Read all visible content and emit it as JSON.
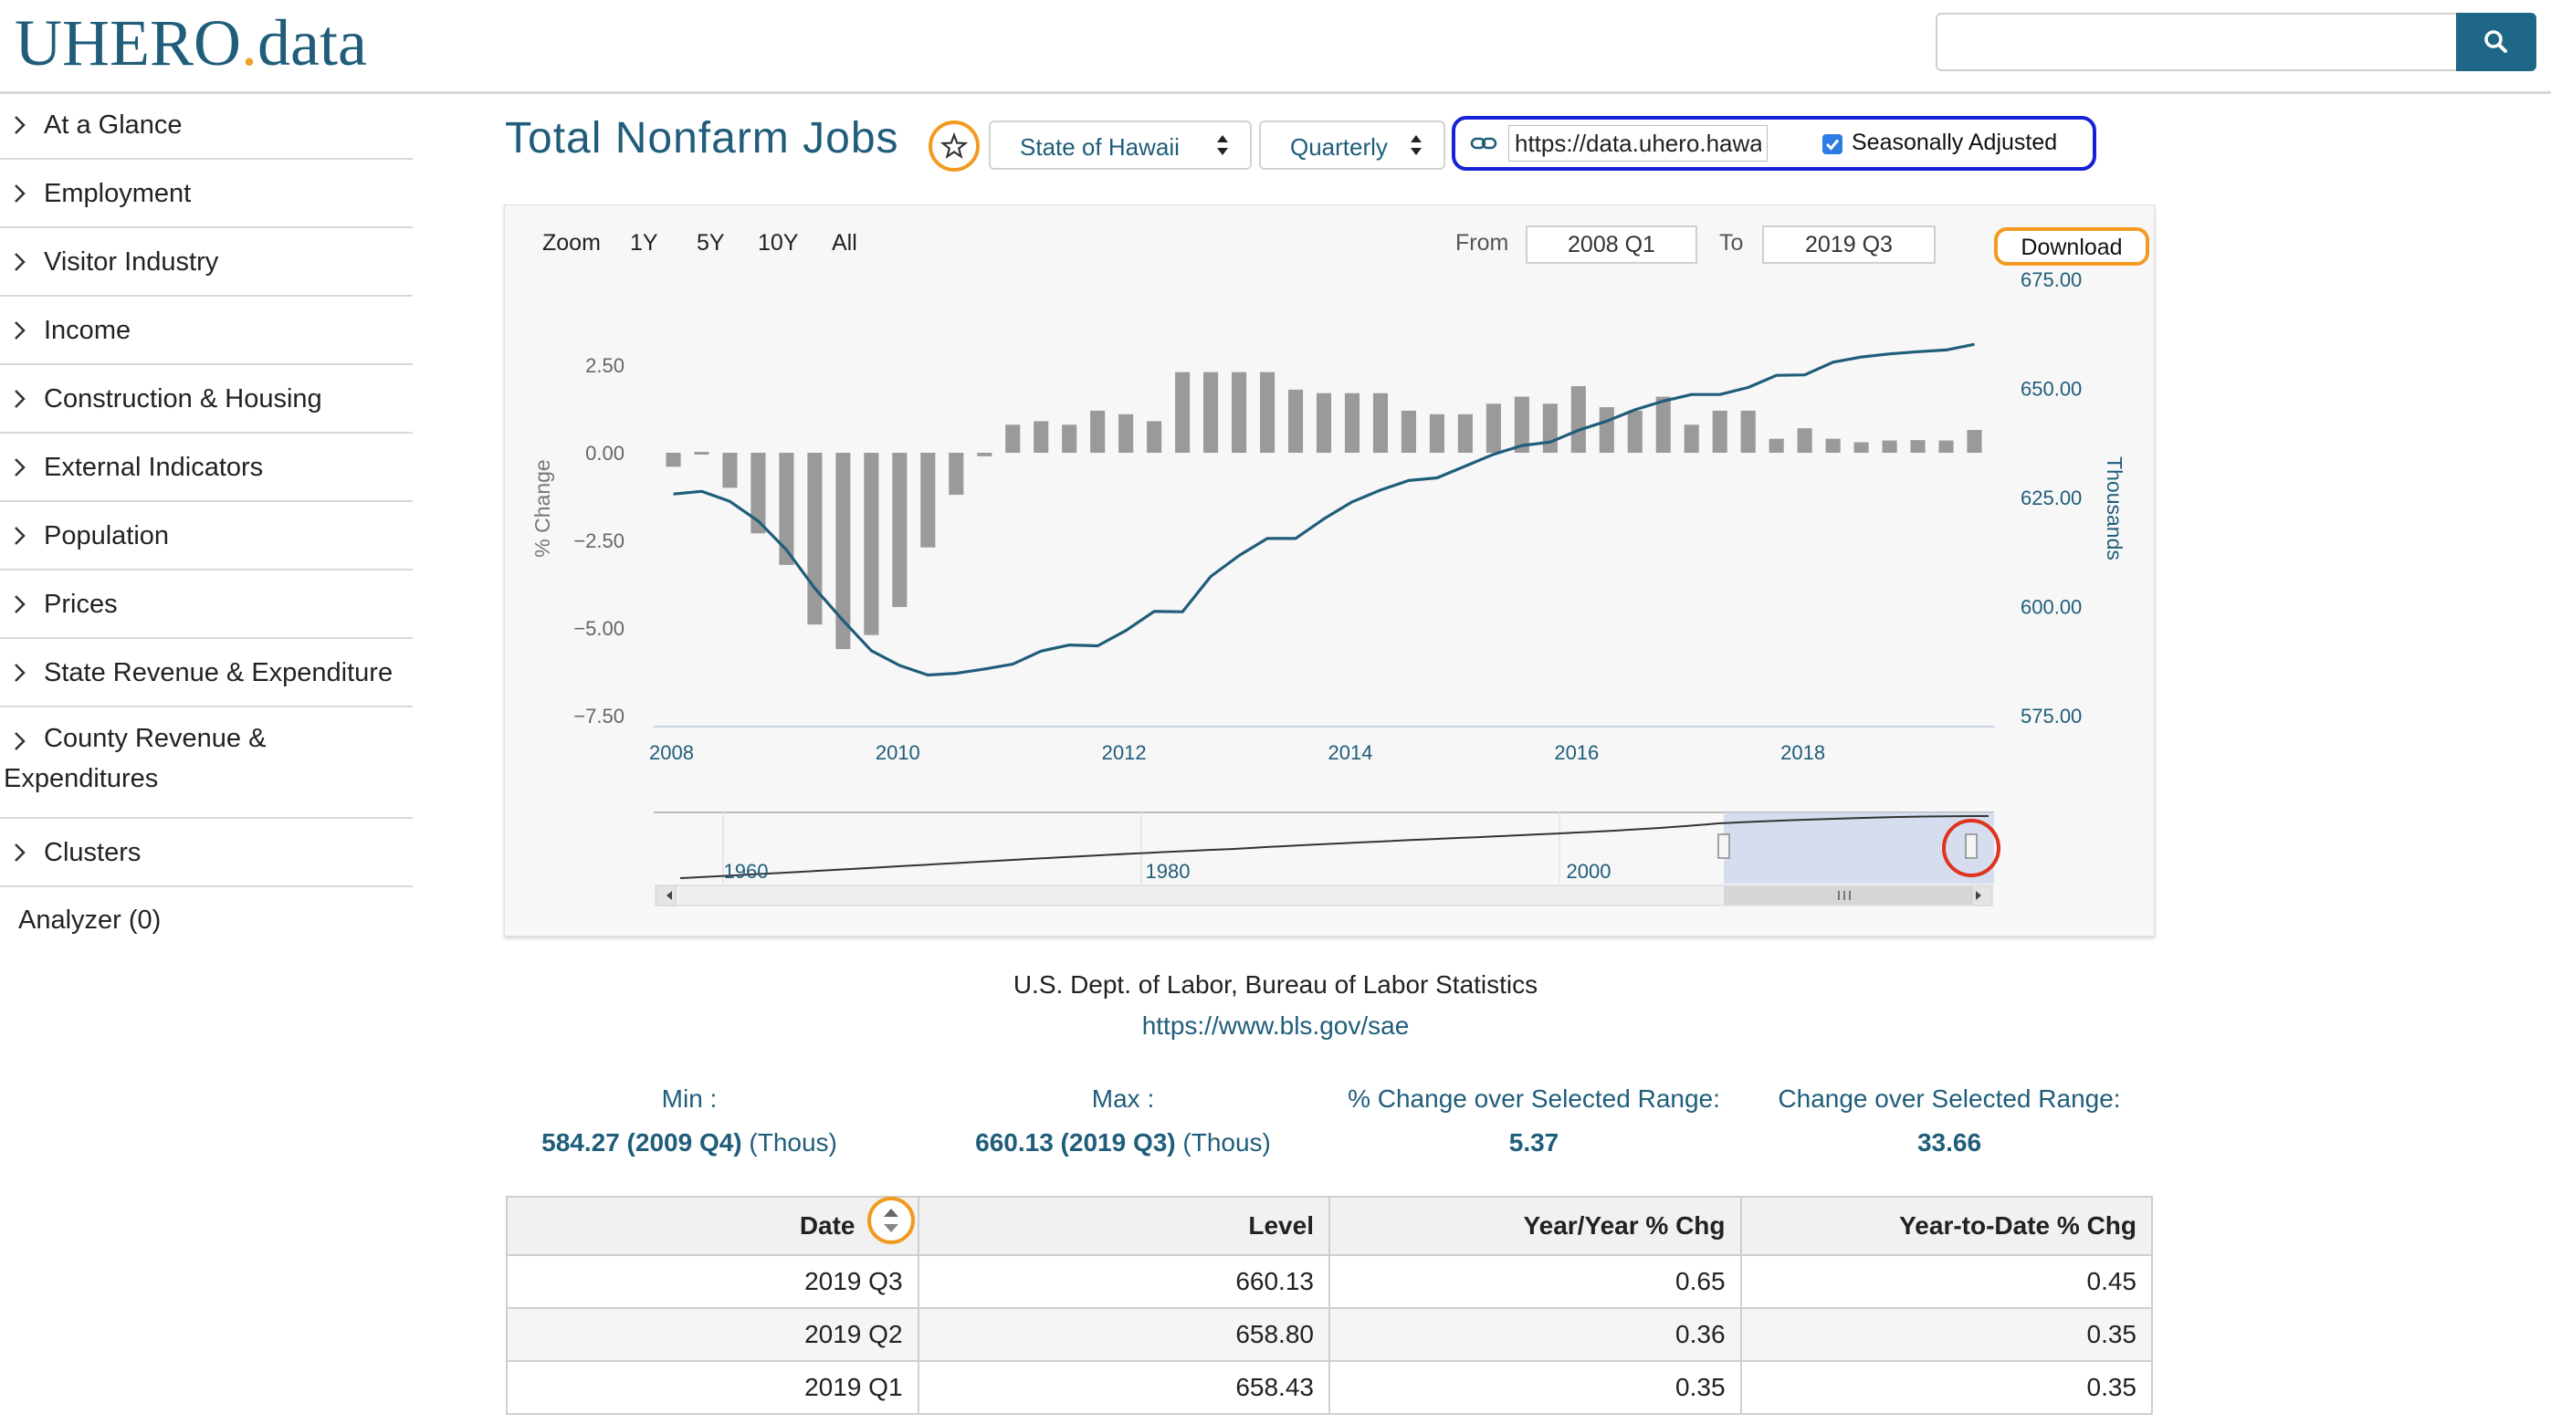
{
  "header": {
    "logo_main": "UHERO",
    "logo_dot": ".",
    "logo_suffix": "data",
    "search_placeholder": ""
  },
  "sidebar": {
    "items": [
      {
        "label": "At a Glance"
      },
      {
        "label": "Employment"
      },
      {
        "label": "Visitor Industry"
      },
      {
        "label": "Income"
      },
      {
        "label": "Construction & Housing"
      },
      {
        "label": "External Indicators"
      },
      {
        "label": "Population"
      },
      {
        "label": "Prices"
      },
      {
        "label": "State Revenue & Expenditure"
      },
      {
        "label": "County Revenue & Expenditures"
      },
      {
        "label": "Clusters"
      }
    ],
    "analyzer": "Analyzer (0)"
  },
  "series": {
    "title": "Total Nonfarm Jobs",
    "geo_select": "State of Hawaii",
    "freq_select": "Quarterly",
    "url_value": "https://data.uhero.hawaii.edu",
    "seasonal_label": "Seasonally Adjusted",
    "seasonal_checked": true
  },
  "chart_controls": {
    "zoom_label": "Zoom",
    "zoom_options": [
      "1Y",
      "5Y",
      "10Y",
      "All"
    ],
    "from_label": "From",
    "from_value": "2008 Q1",
    "to_label": "To",
    "to_value": "2019 Q3",
    "download_label": "Download"
  },
  "chart_data": {
    "type": "bar+line",
    "x": [
      "2008 Q1",
      "2008 Q2",
      "2008 Q3",
      "2008 Q4",
      "2009 Q1",
      "2009 Q2",
      "2009 Q3",
      "2009 Q4",
      "2010 Q1",
      "2010 Q2",
      "2010 Q3",
      "2010 Q4",
      "2011 Q1",
      "2011 Q2",
      "2011 Q3",
      "2011 Q4",
      "2012 Q1",
      "2012 Q2",
      "2012 Q3",
      "2012 Q4",
      "2013 Q1",
      "2013 Q2",
      "2013 Q3",
      "2013 Q4",
      "2014 Q1",
      "2014 Q2",
      "2014 Q3",
      "2014 Q4",
      "2015 Q1",
      "2015 Q2",
      "2015 Q3",
      "2015 Q4",
      "2016 Q1",
      "2016 Q2",
      "2016 Q3",
      "2016 Q4",
      "2017 Q1",
      "2017 Q2",
      "2017 Q3",
      "2017 Q4",
      "2018 Q1",
      "2018 Q2",
      "2018 Q3",
      "2018 Q4",
      "2019 Q1",
      "2019 Q2",
      "2019 Q3"
    ],
    "series": [
      {
        "name": "% Change",
        "type": "bar",
        "axis": "left",
        "values": [
          -0.4,
          0,
          -1.0,
          -2.3,
          -3.2,
          -4.9,
          -5.6,
          -5.2,
          -4.4,
          -2.7,
          -1.2,
          -0.1,
          0.8,
          0.9,
          0.8,
          1.2,
          1.1,
          0.9,
          2.3,
          2.3,
          2.3,
          2.3,
          1.8,
          1.7,
          1.7,
          1.7,
          1.2,
          1.1,
          1.1,
          1.4,
          1.6,
          1.4,
          1.9,
          1.3,
          1.2,
          1.6,
          0.8,
          1.2,
          1.2,
          0.4,
          0.7,
          0.4,
          0.3,
          0.35,
          0.36,
          0.35,
          0.65
        ]
      },
      {
        "name": "Level",
        "type": "line",
        "axis": "right",
        "values": [
          625.8,
          626.4,
          624.1,
          619.6,
          613.0,
          604.2,
          596.8,
          589.9,
          586.5,
          584.3,
          584.7,
          585.7,
          586.8,
          589.8,
          591.2,
          591.0,
          594.5,
          598.9,
          598.8,
          606.9,
          611.7,
          615.6,
          615.6,
          620.1,
          624.0,
          626.7,
          628.9,
          629.5,
          632.2,
          634.9,
          636.9,
          637.7,
          640.4,
          642.5,
          645.1,
          647.1,
          648.6,
          648.6,
          650.2,
          653.0,
          653.1,
          656.0,
          657.2,
          657.9,
          658.4,
          658.8,
          660.1
        ]
      }
    ],
    "y_left": {
      "label": "% Change",
      "ticks": [
        "2.50",
        "0.00",
        "−2.50",
        "−5.00",
        "−7.50"
      ],
      "range": [
        -7.5,
        2.5
      ]
    },
    "y_right": {
      "label": "Thousands",
      "ticks": [
        "675.00",
        "650.00",
        "625.00",
        "600.00",
        "575.00"
      ],
      "range": [
        575,
        675
      ]
    },
    "x_ticks": [
      "2008",
      "2010",
      "2012",
      "2014",
      "2016",
      "2018"
    ],
    "navigator_ticks": [
      "1960",
      "1980",
      "2000"
    ],
    "colors": {
      "bar": "#9a9a9a",
      "line": "#1f5d7a",
      "axis_text": "#1f5d7a"
    }
  },
  "source": {
    "text": "U.S. Dept. of Labor, Bureau of Labor Statistics",
    "url": "https://www.bls.gov/sae"
  },
  "stats": {
    "min_label": "Min :",
    "min_value": "584.27 (2009 Q4)",
    "min_unit": "(Thous)",
    "max_label": "Max :",
    "max_value": "660.13 (2019 Q3)",
    "max_unit": "(Thous)",
    "pct_label": "% Change over Selected Range:",
    "pct_value": "5.37",
    "chg_label": "Change over Selected Range:",
    "chg_value": "33.66"
  },
  "table": {
    "headers": [
      "Date",
      "Level",
      "Year/Year % Chg",
      "Year-to-Date % Chg"
    ],
    "rows": [
      [
        "2019 Q3",
        "660.13",
        "0.65",
        "0.45"
      ],
      [
        "2019 Q2",
        "658.80",
        "0.36",
        "0.35"
      ],
      [
        "2019 Q1",
        "658.43",
        "0.35",
        "0.35"
      ]
    ]
  }
}
